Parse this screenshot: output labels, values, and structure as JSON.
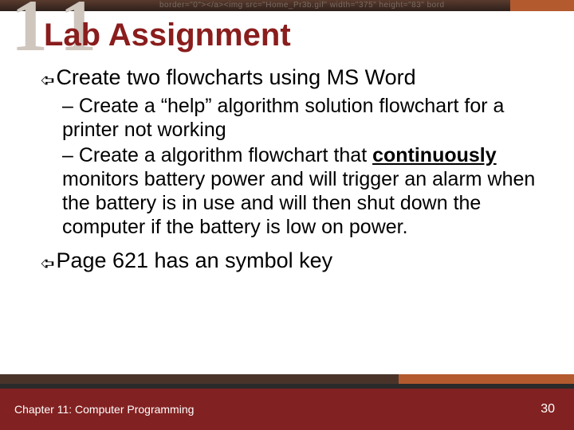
{
  "topbar_code": "border=\"0\"></a><img src=\"Home_Pr3b.gif\" width=\"375\" height=\"83\" bord",
  "chapter_badge": "1 1",
  "title": "Lab Assignment",
  "arrow_glyph": "➪",
  "bullets": {
    "b1": "Create two flowcharts using MS Word",
    "b1_sub1": "Create a “help” algorithm solution flowchart for a printer not working",
    "b1_sub2_before": "Create a algorithm flowchart that ",
    "b1_sub2_bold": "continuously",
    "b1_sub2_after": " monitors battery power and will trigger an alarm when the battery is in use and will then shut down the computer if the battery is low on power.",
    "b2": "Page 621 has an symbol key"
  },
  "footer": {
    "left": "Chapter 11: Computer Programming",
    "page": "30"
  }
}
